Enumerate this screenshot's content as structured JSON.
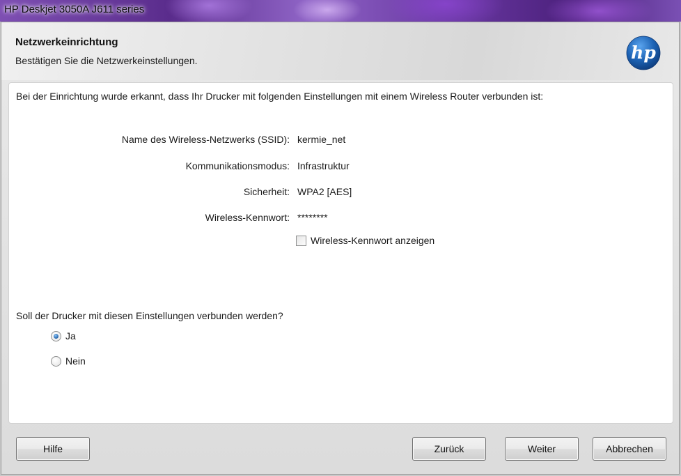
{
  "window": {
    "title": "HP Deskjet 3050A J611 series"
  },
  "header": {
    "title": "Netzwerkeinrichtung",
    "subtitle": "Bestätigen Sie die Netzwerkeinstellungen.",
    "logo_icon": "hp-logo-icon",
    "logo_text": "hp"
  },
  "content": {
    "intro": "Bei der Einrichtung wurde erkannt, dass Ihr Drucker mit folgenden Einstellungen mit einem Wireless Router verbunden ist:",
    "settings": [
      {
        "label": "Name des Wireless-Netzwerks (SSID):",
        "value": "kermie_net"
      },
      {
        "label": "Kommunikationsmodus:",
        "value": "Infrastruktur"
      },
      {
        "label": "Sicherheit:",
        "value": "WPA2 [AES]"
      },
      {
        "label": "Wireless-Kennwort:",
        "value": "********"
      }
    ],
    "show_password": {
      "label": "Wireless-Kennwort anzeigen",
      "checked": false
    },
    "question": "Soll der Drucker mit diesen Einstellungen verbunden werden?",
    "options": [
      {
        "label": "Ja",
        "selected": true
      },
      {
        "label": "Nein",
        "selected": false
      }
    ]
  },
  "buttons": {
    "help": "Hilfe",
    "back": "Zurück",
    "next": "Weiter",
    "cancel": "Abbrechen"
  },
  "colors": {
    "hp_blue": "#1d63b5",
    "radio_selected": "#1e5fa8"
  }
}
